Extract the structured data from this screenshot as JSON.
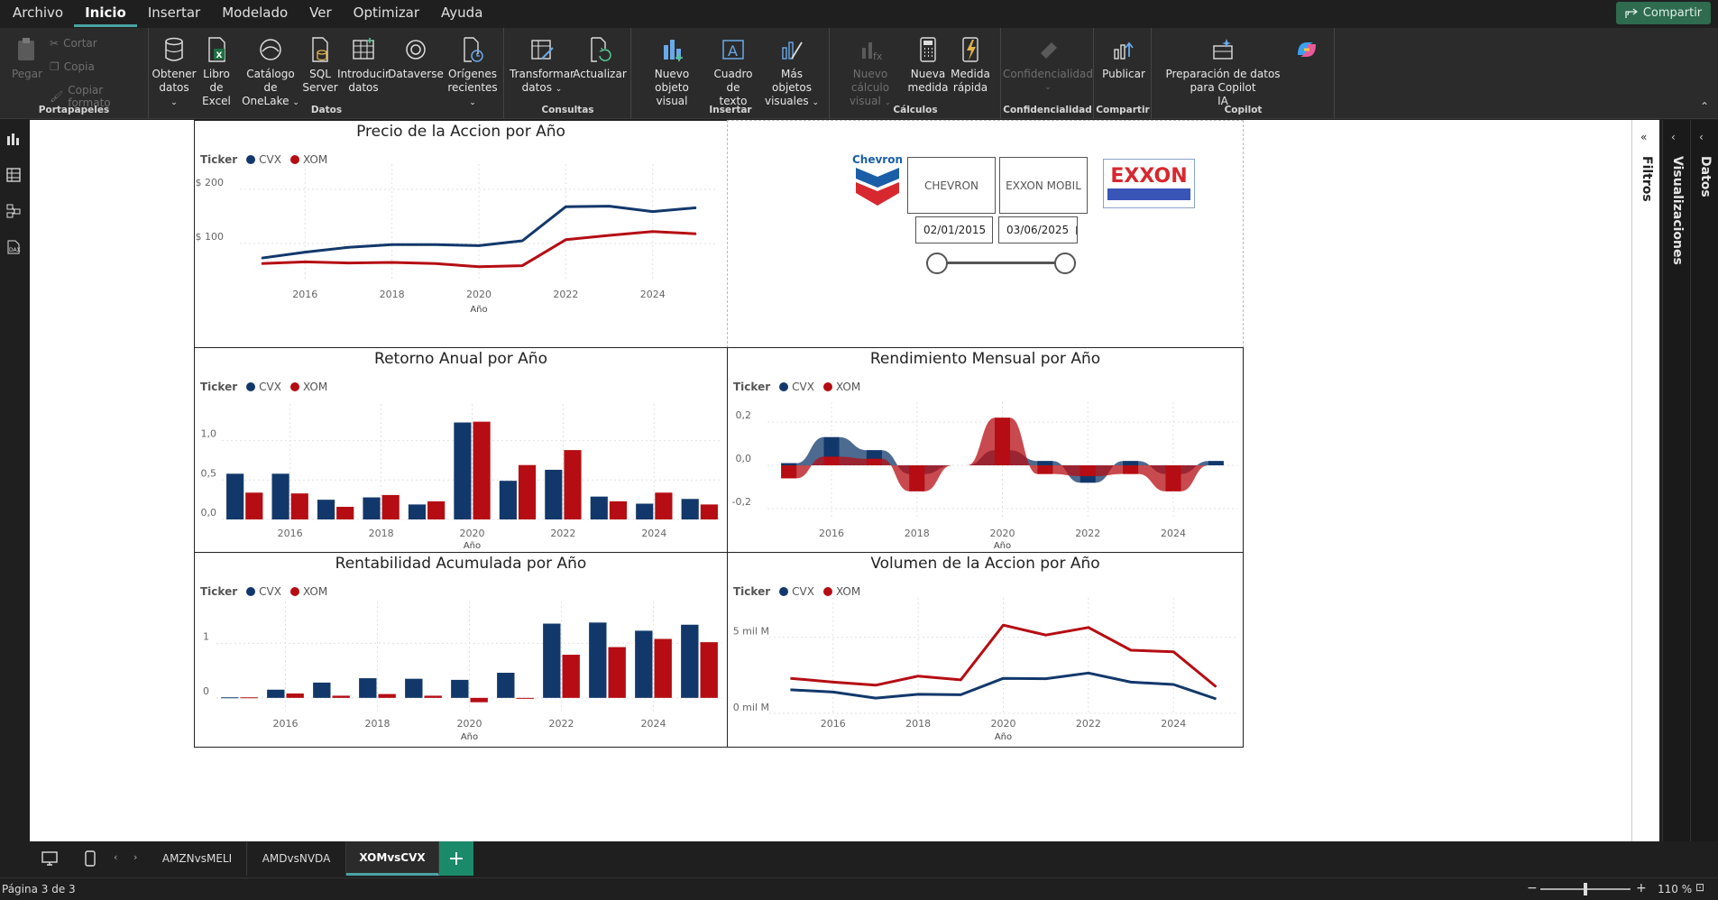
{
  "menu": {
    "items": [
      "Archivo",
      "Inicio",
      "Insertar",
      "Modelado",
      "Ver",
      "Optimizar",
      "Ayuda"
    ],
    "active_index": 1,
    "share_label": "Compartir"
  },
  "ribbon": {
    "portapapeles": {
      "label": "Portapapeles",
      "pegar": "Pegar",
      "cortar": "Cortar",
      "copia": "Copia",
      "copiar_formato": "Copiar formato"
    },
    "datos": {
      "label": "Datos",
      "obtener_1": "Obtener",
      "obtener_2": "datos",
      "excel_1": "Libro de",
      "excel_2": "Excel",
      "onelake_1": "Catálogo de",
      "onelake_2": "OneLake",
      "sql_1": "SQL",
      "sql_2": "Server",
      "introducir_1": "Introducir",
      "introducir_2": "datos",
      "dataverse": "Dataverse",
      "origenes_1": "Orígenes",
      "origenes_2": "recientes"
    },
    "consultas": {
      "label": "Consultas",
      "transformar_1": "Transformar",
      "transformar_2": "datos",
      "actualizar": "Actualizar"
    },
    "insertar": {
      "label": "Insertar",
      "nuevo_1": "Nuevo objeto",
      "nuevo_2": "visual",
      "cuadro_1": "Cuadro de",
      "cuadro_2": "texto",
      "mas_1": "Más objetos",
      "mas_2": "visuales"
    },
    "calculos": {
      "label": "Cálculos",
      "nuevo_calc_1": "Nuevo cálculo",
      "nuevo_calc_2": "visual",
      "medida_1": "Nueva",
      "medida_2": "medida",
      "rapida_1": "Medida",
      "rapida_2": "rápida"
    },
    "confidencialidad": {
      "label": "Confidencialidad",
      "btn": "Confidencialidad"
    },
    "compartir": {
      "label": "Compartir",
      "publicar": "Publicar"
    },
    "copilot": {
      "label": "Copilot",
      "prep_1": "Preparación de datos para Copilot",
      "prep_2": "IA"
    }
  },
  "report": {
    "legend_title": "Ticker",
    "series_names": [
      "CVX",
      "XOM"
    ],
    "colors": {
      "cvx": "#12386b",
      "xom": "#b50d13"
    },
    "x_axis_title": "Año",
    "slicer": {
      "chevron_logo_text": "Chevron",
      "exxon_logo_text": "EXXON",
      "btn_chevron": "CHEVRON",
      "btn_exxon": "EXXON MOBIL",
      "date_from": "02/01/2015",
      "date_to": "03/06/2025"
    }
  },
  "chart_data": [
    {
      "type": "line",
      "title": "Precio de la Accion por Año",
      "xlabel": "Año",
      "x": [
        2015,
        2016,
        2017,
        2018,
        2019,
        2020,
        2021,
        2022,
        2023,
        2024,
        2025
      ],
      "xticks": [
        2016,
        2018,
        2020,
        2022,
        2024
      ],
      "yticks": [
        "$ 100",
        "$ 200"
      ],
      "ylim": [
        30,
        230
      ],
      "series": [
        {
          "name": "CVX",
          "values": [
            73,
            84,
            93,
            98,
            98,
            96,
            105,
            168,
            169,
            159,
            166
          ]
        },
        {
          "name": "XOM",
          "values": [
            63,
            66,
            64,
            65,
            63,
            57,
            59,
            107,
            115,
            122,
            118
          ]
        }
      ]
    },
    {
      "type": "bar",
      "title": "Retorno Anual por Año",
      "xlabel": "Año",
      "categories": [
        2015,
        2016,
        2017,
        2018,
        2019,
        2020,
        2021,
        2022,
        2023,
        2024,
        2025
      ],
      "xticks": [
        2016,
        2018,
        2020,
        2022,
        2024
      ],
      "yticks": [
        "0,0",
        "0,5",
        "1,0"
      ],
      "ylim": [
        0,
        1.35
      ],
      "series": [
        {
          "name": "CVX",
          "values": [
            0.58,
            0.58,
            0.25,
            0.28,
            0.19,
            1.23,
            0.49,
            0.63,
            0.29,
            0.2,
            0.26
          ]
        },
        {
          "name": "XOM",
          "values": [
            0.34,
            0.33,
            0.16,
            0.31,
            0.23,
            1.24,
            0.69,
            0.88,
            0.23,
            0.34,
            0.19
          ]
        }
      ]
    },
    {
      "type": "area",
      "title": "Rendimiento Mensual por Año",
      "xlabel": "Año",
      "categories": [
        2015,
        2016,
        2017,
        2018,
        2019,
        2020,
        2021,
        2022,
        2023,
        2024,
        2025
      ],
      "xticks": [
        2016,
        2018,
        2020,
        2022,
        2024
      ],
      "yticks": [
        "-0,2",
        "0,0",
        "0,2"
      ],
      "ylim": [
        -0.25,
        0.25
      ],
      "series": [
        {
          "name": "CVX",
          "values": [
            0.01,
            0.13,
            0.07,
            -0.04,
            0.0,
            0.07,
            0.02,
            -0.08,
            0.02,
            -0.04,
            0.02
          ]
        },
        {
          "name": "XOM",
          "values": [
            -0.06,
            0.04,
            0.03,
            -0.12,
            0.0,
            0.22,
            -0.04,
            -0.05,
            -0.04,
            -0.12,
            0.0
          ]
        }
      ]
    },
    {
      "type": "bar",
      "title": "Rentabilidad Acumulada por Año",
      "xlabel": "Año",
      "categories": [
        2015,
        2016,
        2017,
        2018,
        2019,
        2020,
        2021,
        2022,
        2023,
        2024,
        2025
      ],
      "xticks": [
        2016,
        2018,
        2020,
        2022,
        2024
      ],
      "yticks": [
        "0",
        "1"
      ],
      "ylim": [
        -0.25,
        1.6
      ],
      "series": [
        {
          "name": "CVX",
          "values": [
            0.01,
            0.15,
            0.28,
            0.36,
            0.35,
            0.33,
            0.46,
            1.36,
            1.38,
            1.23,
            1.34
          ]
        },
        {
          "name": "XOM",
          "values": [
            0.01,
            0.08,
            0.04,
            0.07,
            0.04,
            -0.08,
            -0.01,
            0.79,
            0.93,
            1.08,
            1.02
          ]
        }
      ]
    },
    {
      "type": "line",
      "title": "Volumen de la Accion por Año",
      "xlabel": "Año",
      "x": [
        2015,
        2016,
        2017,
        2018,
        2019,
        2020,
        2021,
        2022,
        2023,
        2024,
        2025
      ],
      "xticks": [
        2016,
        2018,
        2020,
        2022,
        2024
      ],
      "yticks": [
        "0 mil M",
        "5 mil M"
      ],
      "ylim": [
        0,
        7
      ],
      "series": [
        {
          "name": "CVX",
          "values": [
            1.55,
            1.4,
            1.0,
            1.25,
            1.22,
            2.3,
            2.28,
            2.65,
            2.05,
            1.9,
            0.95
          ]
        },
        {
          "name": "XOM",
          "values": [
            2.3,
            2.05,
            1.85,
            2.45,
            2.2,
            5.8,
            5.15,
            5.65,
            4.15,
            4.05,
            1.75
          ]
        }
      ]
    }
  ],
  "tabs": {
    "items": [
      "AMZNvsMELI",
      "AMDvsNVDA",
      "XOMvsCVX"
    ],
    "active_index": 2
  },
  "panes": {
    "filtros": "Filtros",
    "visualizaciones": "Visualizaciones",
    "datos": "Datos"
  },
  "status": {
    "page": "Página 3 de 3",
    "zoom": "110 %"
  }
}
